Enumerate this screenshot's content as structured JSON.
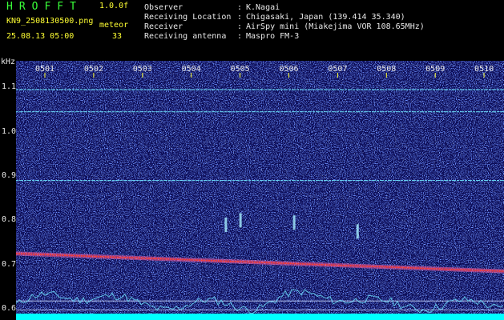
{
  "app": {
    "title": "HROFFT",
    "version": "1.0.0f",
    "filename": "KN9_2508130500.png",
    "mode": "meteor",
    "datetime": "25.08.13 05:00",
    "count": "33"
  },
  "info": [
    {
      "key": "Observer",
      "value": "K.Nagai"
    },
    {
      "key": "Receiving Location",
      "value": "Chigasaki, Japan (139.414 35.340)"
    },
    {
      "key": "Receiver",
      "value": "AirSpy mini (Miakejima VOR 108.65MHz)"
    },
    {
      "key": "Receiving antenna",
      "value": "Maspro FM-3"
    }
  ],
  "separator": ":",
  "colors": {
    "background": "#0b0b55",
    "noise": "#1a3dd0",
    "accent_green": "#39ff39",
    "accent_yellow": "#ffff33",
    "line_cyan": "#6fe6ff",
    "carrier_red": "#ff3a2a",
    "bottom_band": "#00ffff"
  },
  "chart_data": {
    "type": "heatmap",
    "ylabel": "kHz",
    "x_ticks": [
      "0501",
      "0502",
      "0503",
      "0504",
      "0505",
      "0506",
      "0507",
      "0508",
      "0509",
      "0510"
    ],
    "y_ticks": [
      {
        "label": "1.1",
        "value": 1.1
      },
      {
        "label": "1.0",
        "value": 1.0
      },
      {
        "label": "0.9",
        "value": 0.9
      },
      {
        "label": "0.8",
        "value": 0.8
      },
      {
        "label": "0.7",
        "value": 0.7
      },
      {
        "label": "0.6",
        "value": 0.6
      }
    ],
    "ylim": [
      0.575,
      1.16
    ],
    "xlim": [
      0,
      10
    ],
    "horizontal_lines_khz": [
      1.095,
      1.045,
      0.89
    ],
    "reference_lines_khz": [
      0.618,
      0.598
    ],
    "carrier": {
      "khz_start": 0.725,
      "khz_end": 0.685
    },
    "meteor_echoes": [
      {
        "x": 4.3,
        "khz": 0.79
      },
      {
        "x": 4.6,
        "khz": 0.8
      },
      {
        "x": 5.7,
        "khz": 0.795
      },
      {
        "x": 7.0,
        "khz": 0.775
      }
    ]
  }
}
